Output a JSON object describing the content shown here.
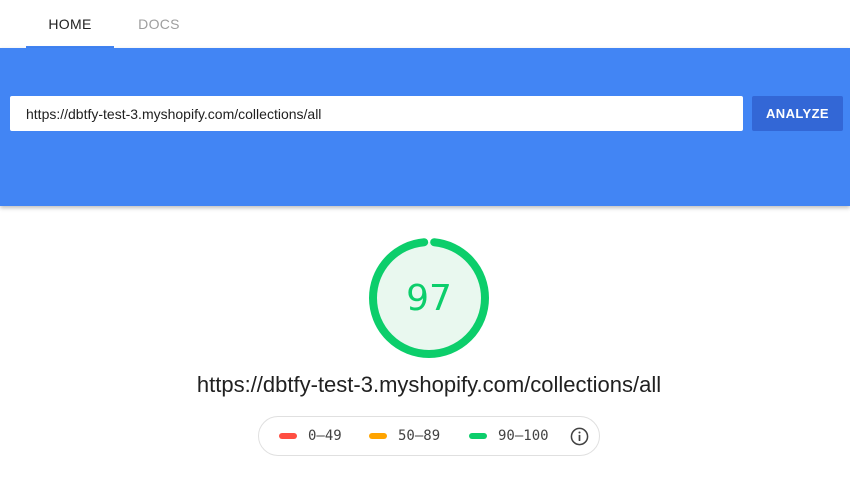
{
  "tabs": {
    "home": "HOME",
    "docs": "DOCS"
  },
  "search": {
    "value": "https://dbtfy-test-3.myshopify.com/collections/all",
    "button_label": "ANALYZE"
  },
  "result": {
    "score": "97",
    "score_fraction": 0.97,
    "url": "https://dbtfy-test-3.myshopify.com/collections/all"
  },
  "legend": {
    "fail_label": "0–49",
    "average_label": "50–89",
    "pass_label": "90–100",
    "info_icon": "info-icon"
  },
  "colors": {
    "banner": "#4285f4",
    "button": "#3367d6",
    "fail": "#ff4e42",
    "average": "#ffa400",
    "pass": "#0cce6b",
    "pass_background": "#e9f8ef"
  }
}
